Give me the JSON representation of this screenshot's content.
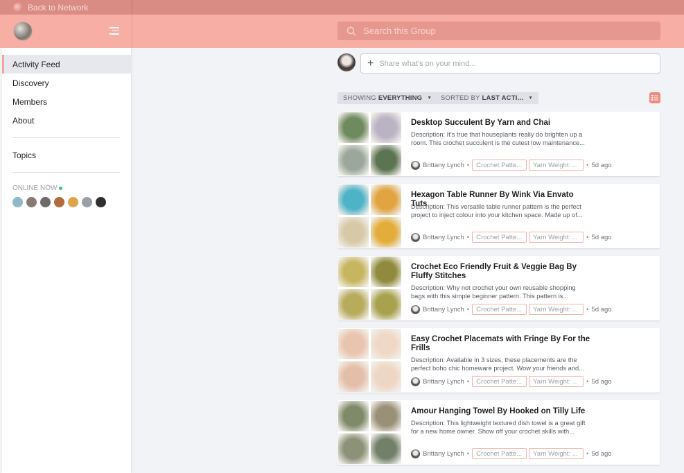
{
  "colors": {
    "accent": "#f7aea4",
    "topbar": "#d98b84",
    "online": "#2ecc71"
  },
  "nav_header": {
    "back_label": "Back to Network"
  },
  "search": {
    "placeholder": "Search this Group",
    "icon": "search-icon"
  },
  "sidebar": {
    "items": [
      {
        "label": "Activity Feed",
        "active": true
      },
      {
        "label": "Discovery"
      },
      {
        "label": "Members"
      },
      {
        "label": "About"
      }
    ],
    "topics_label": "Topics",
    "online_label": "ONLINE NOW",
    "online_avatars": [
      "#8fb9c9",
      "#8a7a72",
      "#6f6a6a",
      "#b36a3c",
      "#e2a44b",
      "#9a9fa6",
      "#2f2f2f"
    ]
  },
  "composer": {
    "placeholder": "Share what's on your mind..."
  },
  "filters": {
    "showing_prefix": "SHOWING",
    "showing_value": "EVERYTHING",
    "sorted_prefix": "SORTED BY",
    "sorted_value": "LAST ACTI..."
  },
  "posts": [
    {
      "title": "Desktop Succulent By Yarn and Chai",
      "description": "Description: It's true that houseplants really do brighten up a room. This crochet succulent is the cutest low maintenance...",
      "author": "Brittany Lynch",
      "tag1": "Crochet Patte...",
      "tag2": "Yarn Weight: ...",
      "time": "5d ago",
      "thumbs": [
        "#6f8a5e",
        "#b9b3c4",
        "#9aa79a",
        "#5c7452"
      ]
    },
    {
      "title": "Hexagon Table Runner By Wink Via Envato Tuts",
      "description": "Description: This versatile table runner pattern is the perfect project to inject colour into your kitchen space. Made up of...",
      "author": "Brittany Lynch",
      "tag1": "Crochet Patte...",
      "tag2": "Yarn Weight: ...",
      "time": "5d ago",
      "thumbs": [
        "#4fb3c8",
        "#e0a440",
        "#d7c9a8",
        "#e3ad3b"
      ]
    },
    {
      "title": "Crochet Eco Friendly Fruit & Veggie Bag By Fluffy Stitches",
      "description": "Description: Why not crochet your own reusable shopping bags with this simple beginner pattern. This pattern is...",
      "author": "Brittany Lynch",
      "tag1": "Crochet Patte...",
      "tag2": "Yarn Weight: ...",
      "time": "5d ago",
      "thumbs": [
        "#c7b660",
        "#8f8a3c",
        "#b7ab5c",
        "#a8a24e"
      ]
    },
    {
      "title": "Easy Crochet Placemats with Fringe By For the Frills",
      "description": "Description: Available in 3 sizes, these placements are the perfect boho chic homeware project. Wow your friends and...",
      "author": "Brittany Lynch",
      "tag1": "Crochet Patte...",
      "tag2": "Yarn Weight: ...",
      "time": "5d ago",
      "thumbs": [
        "#e9c4ae",
        "#efd9c6",
        "#e3bfa9",
        "#eed6c4"
      ]
    },
    {
      "title": "Amour Hanging Towel By Hooked on Tilly Life",
      "description": "Description: This lightweight textured dish towel is a great gift for a new home owner. Show off your crochet skills with...",
      "author": "Brittany Lynch",
      "tag1": "Crochet Patte...",
      "tag2": "Yarn Weight: ...",
      "time": "5d ago",
      "thumbs": [
        "#7f8a6a",
        "#9a8f77",
        "#8b9277",
        "#72806a"
      ]
    }
  ]
}
